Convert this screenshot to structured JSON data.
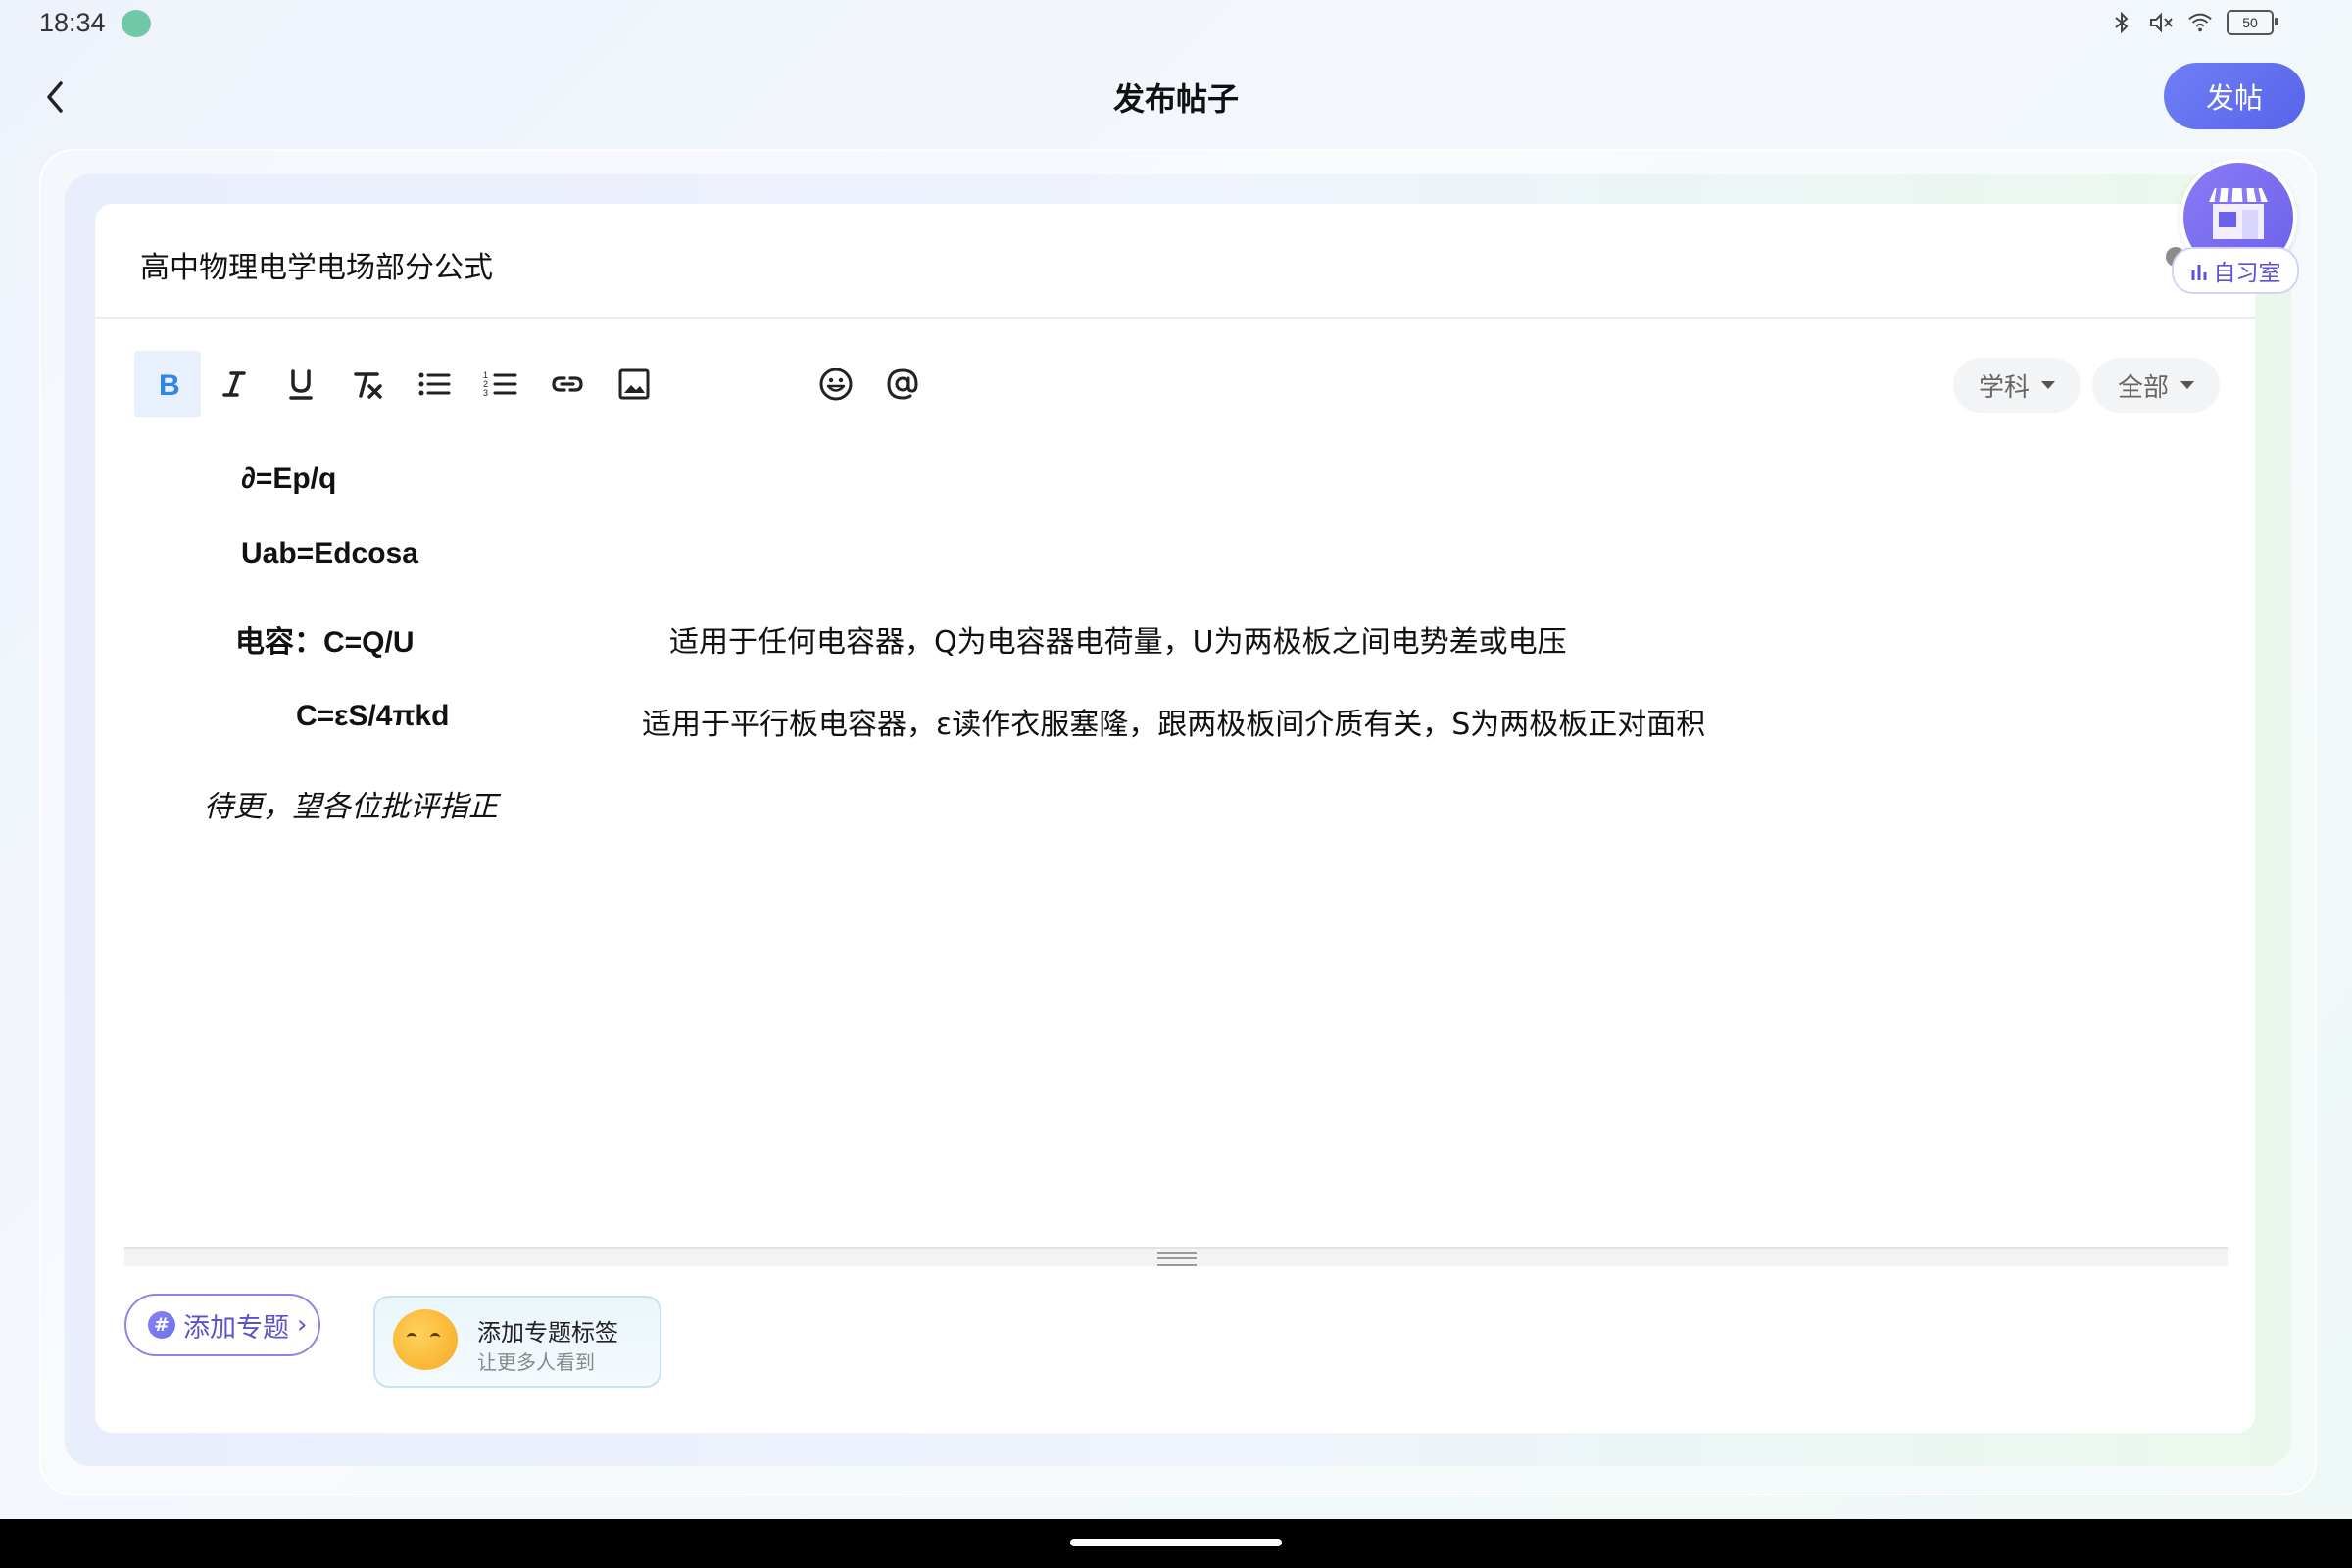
{
  "status": {
    "time": "18:34",
    "battery": "50"
  },
  "header": {
    "title": "发布帖子",
    "publish_label": "发帖"
  },
  "post": {
    "title": "高中物理电学电场部分公式"
  },
  "toolbar": {
    "tools": [
      "bold",
      "italic",
      "underline",
      "clear-format",
      "bullet-list",
      "numbered-list",
      "link",
      "image",
      "emoji",
      "mention"
    ],
    "subject_label": "学科",
    "scope_label": "全部"
  },
  "content": {
    "line1": "∂=Ep/q",
    "line2": "Uab=Edcosa",
    "line3_formula": "电容：C=Q/U",
    "line3_note": "适用于任何电容器，Q为电容器电荷量，U为两极板之间电势差或电压",
    "line4_formula": "C=εS/4πkd",
    "line4_note": "适用于平行板电容器，ε读作衣服塞隆，跟两极板间介质有关，S为两极板正对面积",
    "line5": "待更，望各位批评指正"
  },
  "bottom": {
    "add_topic_label": "添加专题",
    "tip_title": "添加专题标签",
    "tip_subtitle": "让更多人看到"
  },
  "study_room": {
    "label": "自习室"
  }
}
